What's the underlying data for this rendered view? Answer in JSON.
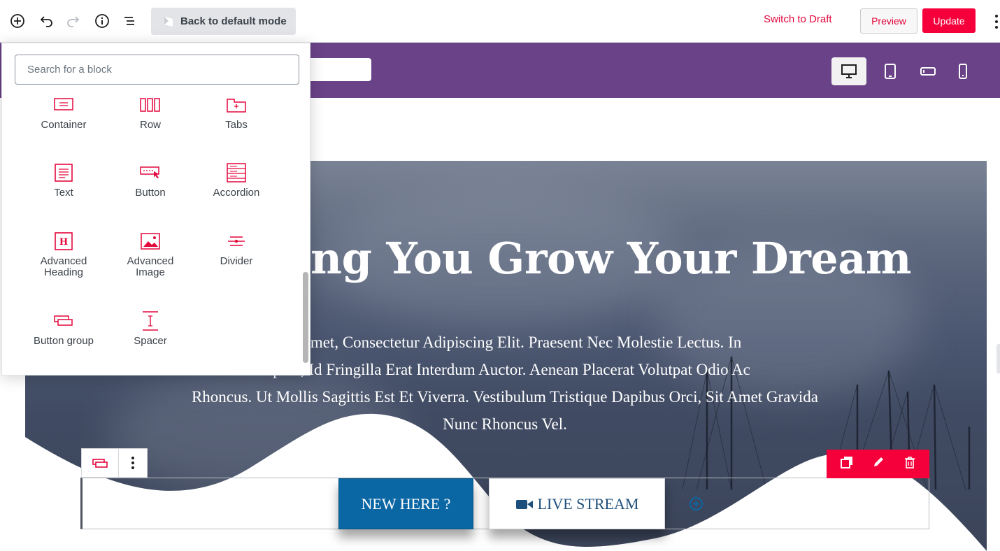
{
  "toolbar": {
    "back_mode_label": "Back to default mode",
    "switch_draft_label": "Switch to Draft",
    "preview_label": "Preview",
    "update_label": "Update"
  },
  "inserter": {
    "search_placeholder": "Search for a block",
    "blocks": [
      {
        "label": "Container",
        "icon": "container-icon"
      },
      {
        "label": "Row",
        "icon": "row-icon"
      },
      {
        "label": "Tabs",
        "icon": "tabs-icon"
      },
      {
        "label": "Text",
        "icon": "text-icon"
      },
      {
        "label": "Button",
        "icon": "button-icon"
      },
      {
        "label": "Accordion",
        "icon": "accordion-icon"
      },
      {
        "label": "Advanced Heading",
        "icon": "advanced-heading-icon"
      },
      {
        "label": "Advanced Image",
        "icon": "advanced-image-icon"
      },
      {
        "label": "Divider",
        "icon": "divider-icon"
      },
      {
        "label": "Button group",
        "icon": "button-group-icon"
      },
      {
        "label": "Spacer",
        "icon": "spacer-icon"
      }
    ]
  },
  "hero": {
    "title": "ng You Grow Your Dream",
    "text_lines": [
      "r Sit Amet, Consectetur Adipiscing Elit. Praesent Nec Molestie Lectus. In",
      "sapien, Id Fringilla Erat Interdum Auctor. Aenean Placerat Volutpat Odio Ac",
      "Rhoncus. Ut Mollis Sagittis Est Et Viverra. Vestibulum Tristique Dapibus Orci, Sit Amet Gravida",
      "Nunc Rhoncus Vel."
    ]
  },
  "buttons": {
    "new_here": "NEW HERE ?",
    "live_stream": "LIVE STREAM"
  },
  "colors": {
    "accent": "#f5003a",
    "purple_bar": "#6a4287",
    "primary_button": "#0b67a3"
  }
}
